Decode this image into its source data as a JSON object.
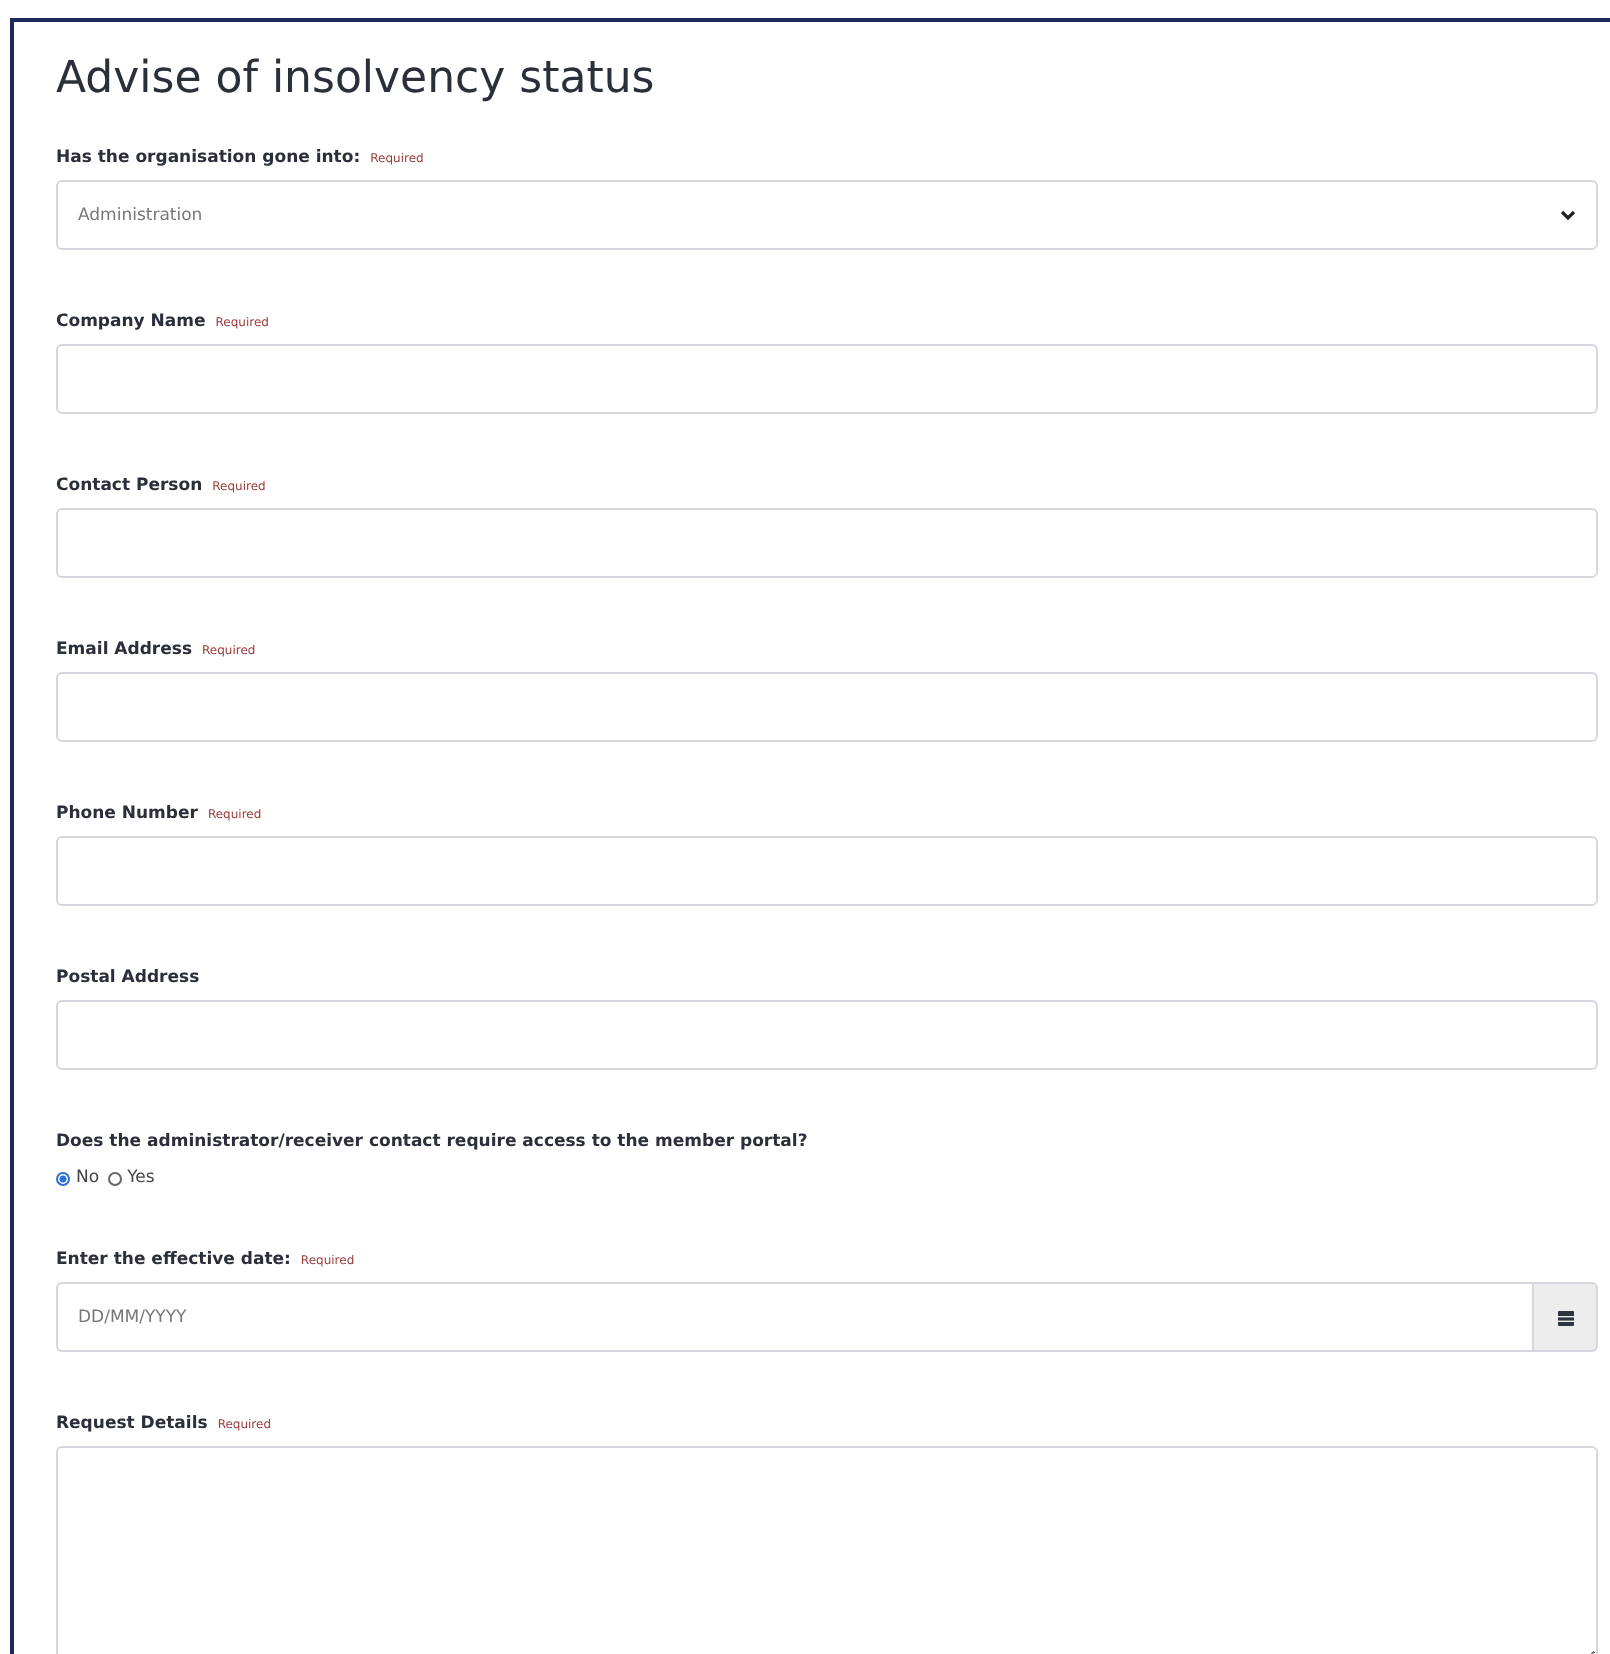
{
  "title": "Advise of insolvency status",
  "fields": [
    {
      "kind": "select",
      "label": "Has the organisation gone into:",
      "required_text": "Required",
      "value": "Administration"
    },
    {
      "kind": "text",
      "label": "Company Name",
      "required_text": "Required"
    },
    {
      "kind": "text",
      "label": "Contact Person",
      "required_text": "Required"
    },
    {
      "kind": "text",
      "label": "Email Address",
      "required_text": "Required"
    },
    {
      "kind": "text",
      "label": "Phone Number",
      "required_text": "Required"
    },
    {
      "kind": "text",
      "label": "Postal Address"
    },
    {
      "kind": "radio",
      "label": "Does the administrator/receiver contact require access to the member portal?",
      "options": [
        {
          "label": "No",
          "selected": true
        },
        {
          "label": "Yes",
          "selected": false
        }
      ]
    },
    {
      "kind": "date",
      "label": "Enter the effective date:",
      "required_text": "Required",
      "placeholder": "DD/MM/YYYY"
    },
    {
      "kind": "textarea",
      "label": "Request Details",
      "required_text": "Required"
    }
  ]
}
